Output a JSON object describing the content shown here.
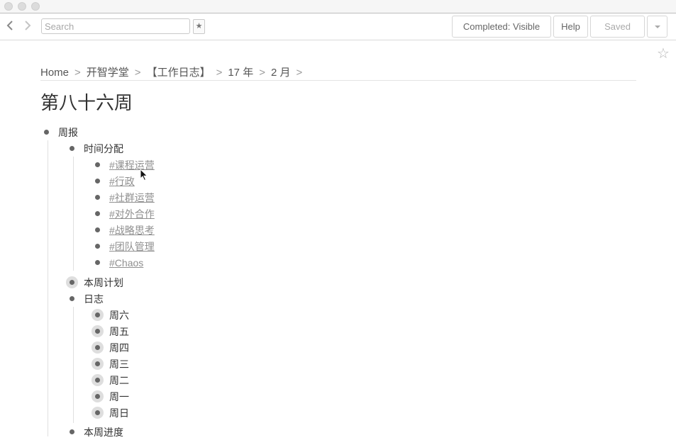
{
  "window": {
    "controls": [
      "close",
      "minimize",
      "zoom"
    ]
  },
  "toolbar": {
    "back_icon": "chevron-left-icon",
    "forward_icon": "chevron-right-icon",
    "search_placeholder": "Search",
    "search_value": "",
    "star_icon": "star-icon",
    "completed_label": "Completed: Visible",
    "help_label": "Help",
    "saved_label": "Saved",
    "menu_icon": "chevron-down-icon"
  },
  "page": {
    "star_icon": "star-outline-icon",
    "breadcrumb": [
      "Home",
      "开智学堂",
      "【工作日志】",
      "17 年",
      "2 月"
    ],
    "breadcrumb_separator": ">",
    "title": "第八十六周"
  },
  "outline": {
    "root": {
      "label": "周报"
    },
    "time_allocation": {
      "label": "时间分配",
      "tags": [
        "课程运营",
        "行政",
        "社群运营",
        "对外合作",
        "战略思考",
        "团队管理",
        "Chaos"
      ],
      "tag_prefix": "#"
    },
    "weekly_plan": {
      "label": "本周计划",
      "collapsed": true
    },
    "log": {
      "label": "日志",
      "days": [
        "周六",
        "周五",
        "周四",
        "周三",
        "周二",
        "周一",
        "周日"
      ],
      "days_collapsed": true
    },
    "weekly_progress": {
      "label": "本周进度"
    }
  },
  "colors": {
    "tag_link": "#8f8f8f",
    "bullet": "#666666",
    "collapsed_halo": "#dedede",
    "text": "#333333"
  }
}
